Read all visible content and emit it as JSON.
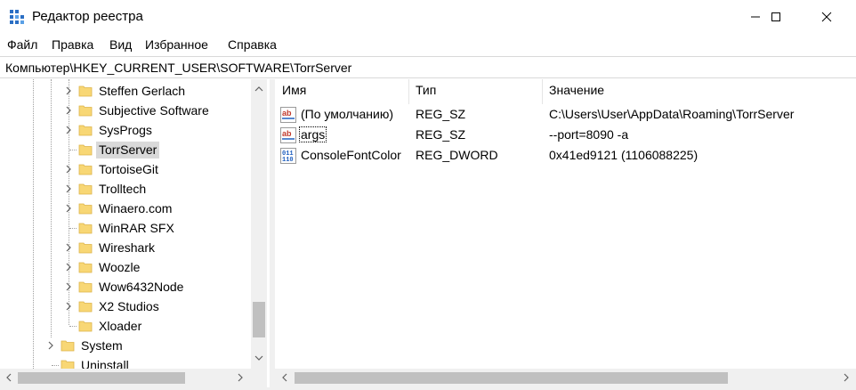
{
  "window": {
    "title": "Редактор реестра",
    "icon": "regedit-icon",
    "controls": [
      "minimize-icon",
      "maximize-icon",
      "close-icon"
    ]
  },
  "menu": [
    "Файл",
    "Правка",
    "Вид",
    "Избранное",
    "Справка"
  ],
  "address": "Компьютер\\HKEY_CURRENT_USER\\SOFTWARE\\TorrServer",
  "tree": {
    "items": [
      {
        "label": "Steffen Gerlach",
        "expandable": true,
        "selected": false
      },
      {
        "label": "Subjective Software",
        "expandable": true,
        "selected": false
      },
      {
        "label": "SysProgs",
        "expandable": true,
        "selected": false
      },
      {
        "label": "TorrServer",
        "expandable": false,
        "selected": true
      },
      {
        "label": "TortoiseGit",
        "expandable": true,
        "selected": false
      },
      {
        "label": "Trolltech",
        "expandable": true,
        "selected": false
      },
      {
        "label": "Winaero.com",
        "expandable": true,
        "selected": false
      },
      {
        "label": "WinRAR SFX",
        "expandable": false,
        "selected": false
      },
      {
        "label": "Wireshark",
        "expandable": true,
        "selected": false
      },
      {
        "label": "Woozle",
        "expandable": true,
        "selected": false
      },
      {
        "label": "Wow6432Node",
        "expandable": true,
        "selected": false
      },
      {
        "label": "X2 Studios",
        "expandable": true,
        "selected": false
      },
      {
        "label": "Xloader",
        "expandable": false,
        "selected": false
      },
      {
        "label": "System",
        "expandable": true,
        "selected": false
      },
      {
        "label": "Uninstall",
        "expandable": false,
        "selected": false
      }
    ]
  },
  "values": {
    "columns": {
      "name": "Имя",
      "type": "Тип",
      "data": "Значение"
    },
    "rows": [
      {
        "name": "(По умолчанию)",
        "type": "REG_SZ",
        "data": "C:\\Users\\User\\AppData\\Roaming\\TorrServer",
        "icon": "string-value-icon"
      },
      {
        "name": "args",
        "type": "REG_SZ",
        "data": "--port=8090 -a",
        "icon": "string-value-icon"
      },
      {
        "name": "ConsoleFontColor",
        "type": "REG_DWORD",
        "data": "0x41ed9121 (1106088225)",
        "icon": "binary-value-icon"
      }
    ]
  }
}
